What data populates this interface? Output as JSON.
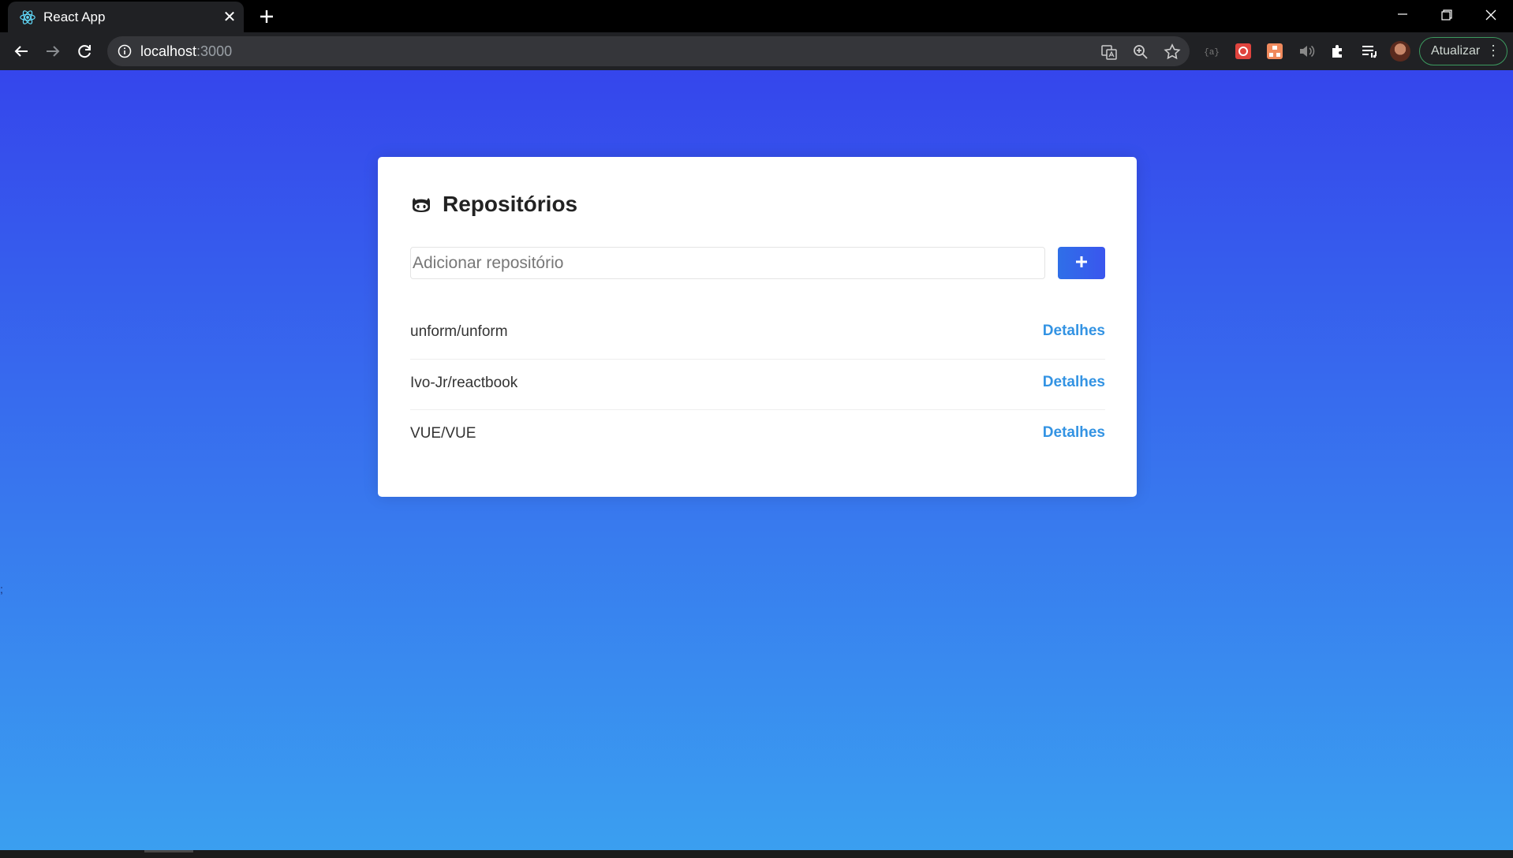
{
  "browser": {
    "tab_title": "React App",
    "url_host": "localhost",
    "url_port": ":3000",
    "update_label": "Atualizar",
    "update_menu": "⋮",
    "close_glyph": "✕"
  },
  "page": {
    "title": "Repositórios",
    "input_placeholder": "Adicionar repositório",
    "add_button_icon": "plus-icon",
    "stray_text": ";",
    "repositories": [
      {
        "name": "unform/unform",
        "link_label": "Detalhes"
      },
      {
        "name": "Ivo-Jr/reactbook",
        "link_label": "Detalhes"
      },
      {
        "name": "VUE/VUE",
        "link_label": "Detalhes"
      }
    ]
  },
  "colors": {
    "gradient_top": "#3546ec",
    "gradient_bottom": "#3a9ff0",
    "link": "#3393e3",
    "button": "#3a56ee"
  }
}
